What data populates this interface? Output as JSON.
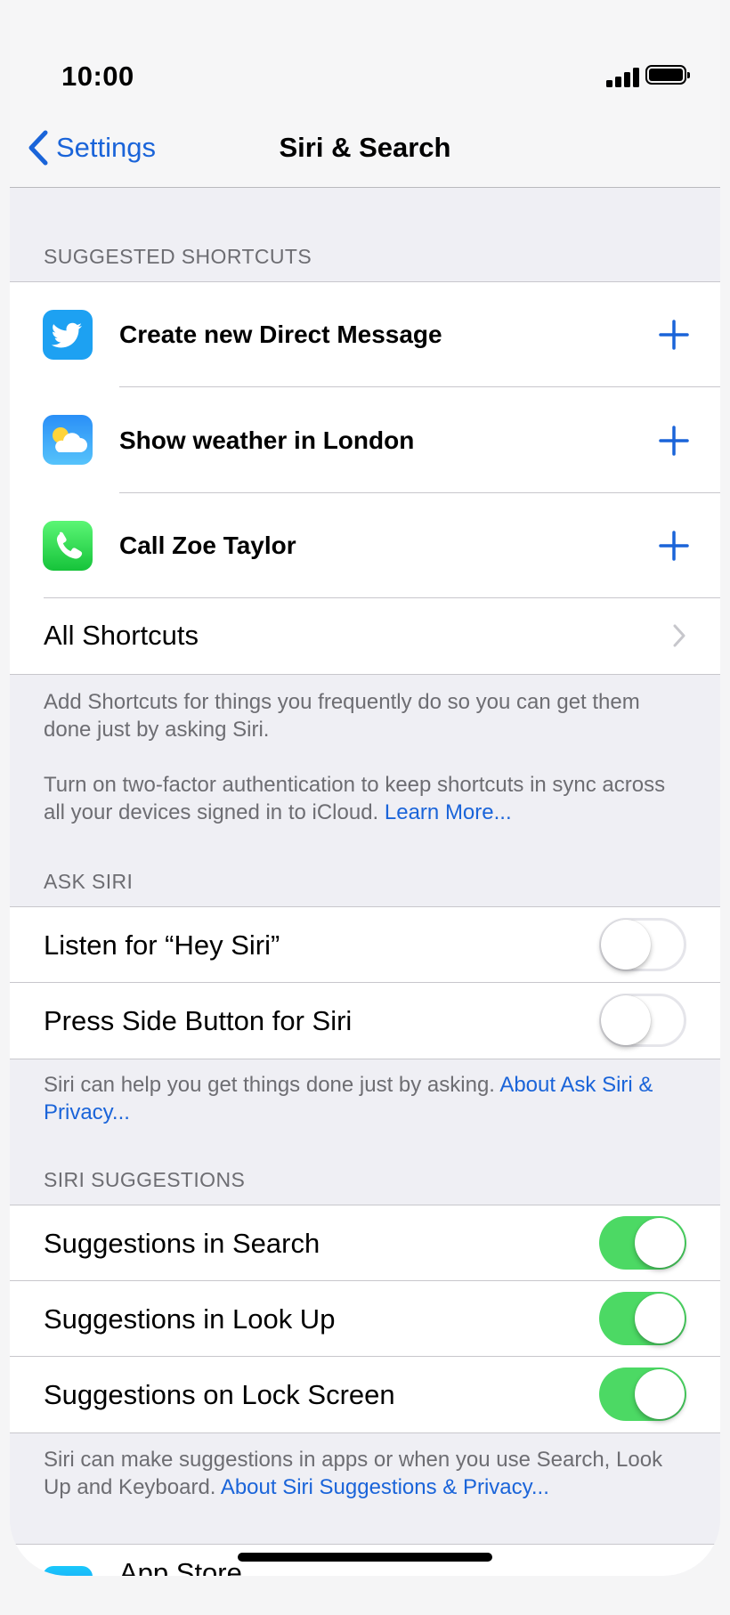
{
  "status_bar": {
    "time": "10:00"
  },
  "nav": {
    "back_label": "Settings",
    "title": "Siri & Search"
  },
  "suggested_shortcuts": {
    "header": "SUGGESTED SHORTCUTS",
    "items": [
      {
        "label": "Create new Direct Message",
        "icon": "twitter-icon"
      },
      {
        "label": "Show weather in London",
        "icon": "weather-icon"
      },
      {
        "label": "Call Zoe Taylor",
        "icon": "phone-icon"
      }
    ],
    "all_label": "All Shortcuts",
    "footer_1": "Add Shortcuts for things you frequently do so you can get them done just by asking Siri.",
    "footer_2": "Turn on two-factor authentication to keep shortcuts in sync across all your devices signed in to iCloud.",
    "footer_2_link": "Learn More..."
  },
  "ask_siri": {
    "header": "ASK SIRI",
    "items": [
      {
        "label": "Listen for “Hey Siri”",
        "state": "off"
      },
      {
        "label": "Press Side Button for Siri",
        "state": "off"
      }
    ],
    "footer": "Siri can help you get things done just by asking.",
    "footer_link": "About Ask Siri & Privacy..."
  },
  "siri_suggestions": {
    "header": "SIRI SUGGESTIONS",
    "items": [
      {
        "label": "Suggestions in Search",
        "state": "on"
      },
      {
        "label": "Suggestions in Look Up",
        "state": "on"
      },
      {
        "label": "Suggestions on Lock Screen",
        "state": "on"
      }
    ],
    "footer": "Siri can make suggestions in apps or when you use Search, Look Up and Keyboard.",
    "footer_link": "About Siri Suggestions & Privacy..."
  },
  "apps": {
    "first_label": "App Store"
  },
  "colors": {
    "accent": "#1a64d9",
    "toggle_on": "#4cd964",
    "background": "#efeff4"
  }
}
